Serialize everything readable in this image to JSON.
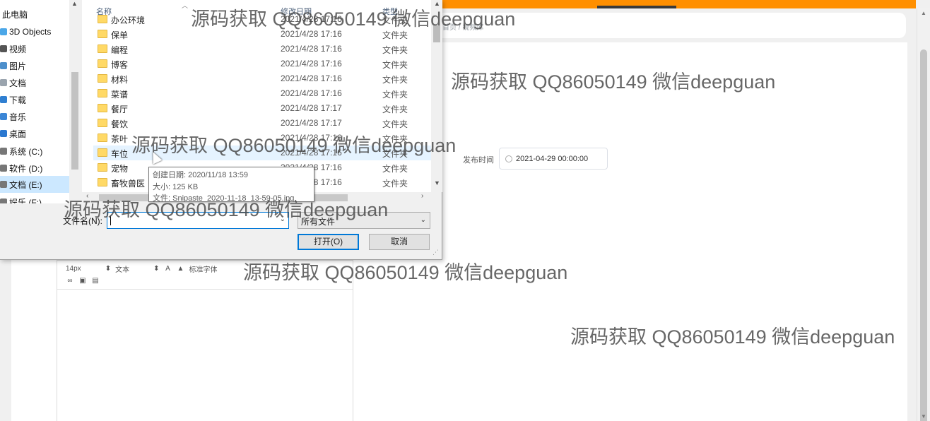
{
  "background_app": {
    "breadcrumb": "首页 / 视频库",
    "publish_label": "发布时间",
    "publish_value": "2021-04-29 00:00:00",
    "editor_toolbar": {
      "font_size": "14px",
      "block_type": "文本",
      "font_family": "标准字体",
      "icons": [
        "font-color-icon",
        "background-color-icon",
        "link-icon",
        "image-icon",
        "video-icon"
      ]
    }
  },
  "dialog": {
    "nav_items": [
      {
        "label": "此电脑",
        "icon": "computer-icon"
      },
      {
        "label": "3D Objects",
        "icon": "3d-objects-icon"
      },
      {
        "label": "视频",
        "icon": "video-folder-icon"
      },
      {
        "label": "图片",
        "icon": "picture-folder-icon"
      },
      {
        "label": "文档",
        "icon": "document-folder-icon"
      },
      {
        "label": "下载",
        "icon": "download-folder-icon"
      },
      {
        "label": "音乐",
        "icon": "music-folder-icon"
      },
      {
        "label": "桌面",
        "icon": "desktop-folder-icon"
      },
      {
        "label": "系统 (C:)",
        "icon": "drive-icon"
      },
      {
        "label": "软件 (D:)",
        "icon": "drive-icon"
      },
      {
        "label": "文档 (E:)",
        "icon": "drive-icon",
        "selected": true
      },
      {
        "label": "娱乐 (F:)",
        "icon": "drive-icon"
      }
    ],
    "columns": {
      "name": "名称",
      "modified": "修改日期",
      "type": "类型"
    },
    "files": [
      {
        "name": "办公环境",
        "date": "2021/4/28 17:16",
        "type": "文件夹"
      },
      {
        "name": "保单",
        "date": "2021/4/28 17:16",
        "type": "文件夹"
      },
      {
        "name": "编程",
        "date": "2021/4/28 17:16",
        "type": "文件夹"
      },
      {
        "name": "博客",
        "date": "2021/4/28 17:16",
        "type": "文件夹"
      },
      {
        "name": "材料",
        "date": "2021/4/28 17:16",
        "type": "文件夹"
      },
      {
        "name": "菜谱",
        "date": "2021/4/28 17:16",
        "type": "文件夹"
      },
      {
        "name": "餐厅",
        "date": "2021/4/28 17:17",
        "type": "文件夹"
      },
      {
        "name": "餐饮",
        "date": "2021/4/28 17:17",
        "type": "文件夹"
      },
      {
        "name": "茶叶",
        "date": "2021/4/28 17:16",
        "type": "文件夹"
      },
      {
        "name": "车位",
        "date": "2021/4/28 17:16",
        "type": "文件夹"
      },
      {
        "name": "宠物",
        "date": "2021/4/28 17:16",
        "type": "文件夹"
      },
      {
        "name": "畜牧兽医",
        "date": "2021/4/28 17:16",
        "type": "文件夹"
      }
    ],
    "hovered_file": "车位",
    "tooltip": {
      "created": "创建日期: 2020/11/18 13:59",
      "size": "大小: 125 KB",
      "files": "文件: Snipaste_2020-11-18_13-59-05.jpg"
    },
    "filename_label": "文件名(N):",
    "filename_value": "",
    "filetype_value": "所有文件",
    "open_button": "打开(O)",
    "cancel_button": "取消"
  },
  "watermark_text": "源码获取 QQ86050149 微信deepguan",
  "colors": {
    "accent_orange": "#ff8f00",
    "selection_blue": "#cce8ff",
    "focus_blue": "#0078d7",
    "folder_yellow": "#ffd966"
  }
}
